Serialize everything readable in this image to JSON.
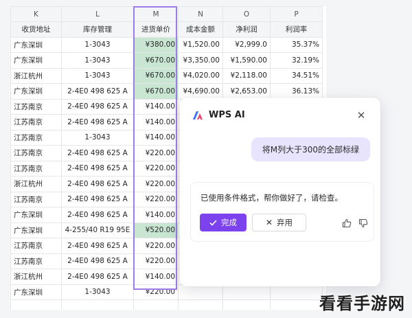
{
  "sheet": {
    "col_letters": [
      "K",
      "L",
      "M",
      "N",
      "O",
      "P"
    ],
    "headers": [
      "收货地址",
      "库存管理",
      "进货单价",
      "成本金额",
      "净利润",
      "利润率"
    ],
    "rows": [
      {
        "k": "广东深圳",
        "l": "1-3043",
        "m": "¥380.00",
        "n": "¥1,520.00",
        "o": "¥2,999.0",
        "p": "35.37%",
        "hl": true
      },
      {
        "k": "广东深圳",
        "l": "1-3043",
        "m": "¥670.00",
        "n": "¥3,350.00",
        "o": "¥1,590.00",
        "p": "32.19%",
        "hl": true
      },
      {
        "k": "浙江杭州",
        "l": "1-3043",
        "m": "¥670.00",
        "n": "¥4,020.00",
        "o": "¥2,118.00",
        "p": "34.51%",
        "hl": true
      },
      {
        "k": "广东深圳",
        "l": "2-4E0 498 625 A",
        "m": "¥670.00",
        "n": "¥4,690.00",
        "o": "¥2,653.00",
        "p": "36.13%",
        "hl": true
      },
      {
        "k": "江苏南京",
        "l": "2-4E0 498 625 A",
        "m": "¥140.00",
        "n": "",
        "o": "",
        "p": "",
        "hl": false
      },
      {
        "k": "江苏南京",
        "l": "2-4E0 498 625 A",
        "m": "¥140.00",
        "n": "",
        "o": "",
        "p": "",
        "hl": false
      },
      {
        "k": "江苏南京",
        "l": "1-3043",
        "m": "¥140.00",
        "n": "",
        "o": "",
        "p": "",
        "hl": false
      },
      {
        "k": "江苏南京",
        "l": "2-4E0 498 625 A",
        "m": "¥220.00",
        "n": "",
        "o": "",
        "p": "",
        "hl": false
      },
      {
        "k": "江苏南京",
        "l": "2-4E0 498 625 A",
        "m": "¥220.00",
        "n": "",
        "o": "",
        "p": "",
        "hl": false
      },
      {
        "k": "浙江杭州",
        "l": "2-4E0 498 625 A",
        "m": "¥220.00",
        "n": "",
        "o": "",
        "p": "",
        "hl": false
      },
      {
        "k": "江苏南京",
        "l": "2-4E0 498 625 A",
        "m": "¥220.00",
        "n": "",
        "o": "",
        "p": "",
        "hl": false
      },
      {
        "k": "广东深圳",
        "l": "2-4E0 498 625 A",
        "m": "¥140.00",
        "n": "",
        "o": "",
        "p": "",
        "hl": false
      },
      {
        "k": "广东深圳",
        "l": "4-255/40 R19 95E",
        "m": "¥520.00",
        "n": "",
        "o": "",
        "p": "",
        "hl": true
      },
      {
        "k": "江苏南京",
        "l": "2-4E0 498 625 A",
        "m": "¥220.00",
        "n": "",
        "o": "",
        "p": "",
        "hl": false
      },
      {
        "k": "江苏南京",
        "l": "2-4E0 498 625 A",
        "m": "¥220.00",
        "n": "",
        "o": "",
        "p": "",
        "hl": false
      },
      {
        "k": "浙江杭州",
        "l": "2-4E0 498 625 A",
        "m": "¥140.00",
        "n": "",
        "o": "",
        "p": "",
        "hl": false
      },
      {
        "k": "广东深圳",
        "l": "1-3043",
        "m": "¥220.00",
        "n": "",
        "o": "",
        "p": "",
        "hl": false
      }
    ]
  },
  "panel": {
    "title": "WPS AI",
    "user_message": "将M列大于300的全部标绿",
    "ai_reply": "已使用条件格式，帮你做好了，请检查。",
    "done_label": "完成",
    "discard_label": "弃用"
  },
  "colors": {
    "accent": "#7b42ed",
    "highlight": "#c8e6d2",
    "outline": "#9d7be8"
  },
  "watermark": "看看手游网"
}
